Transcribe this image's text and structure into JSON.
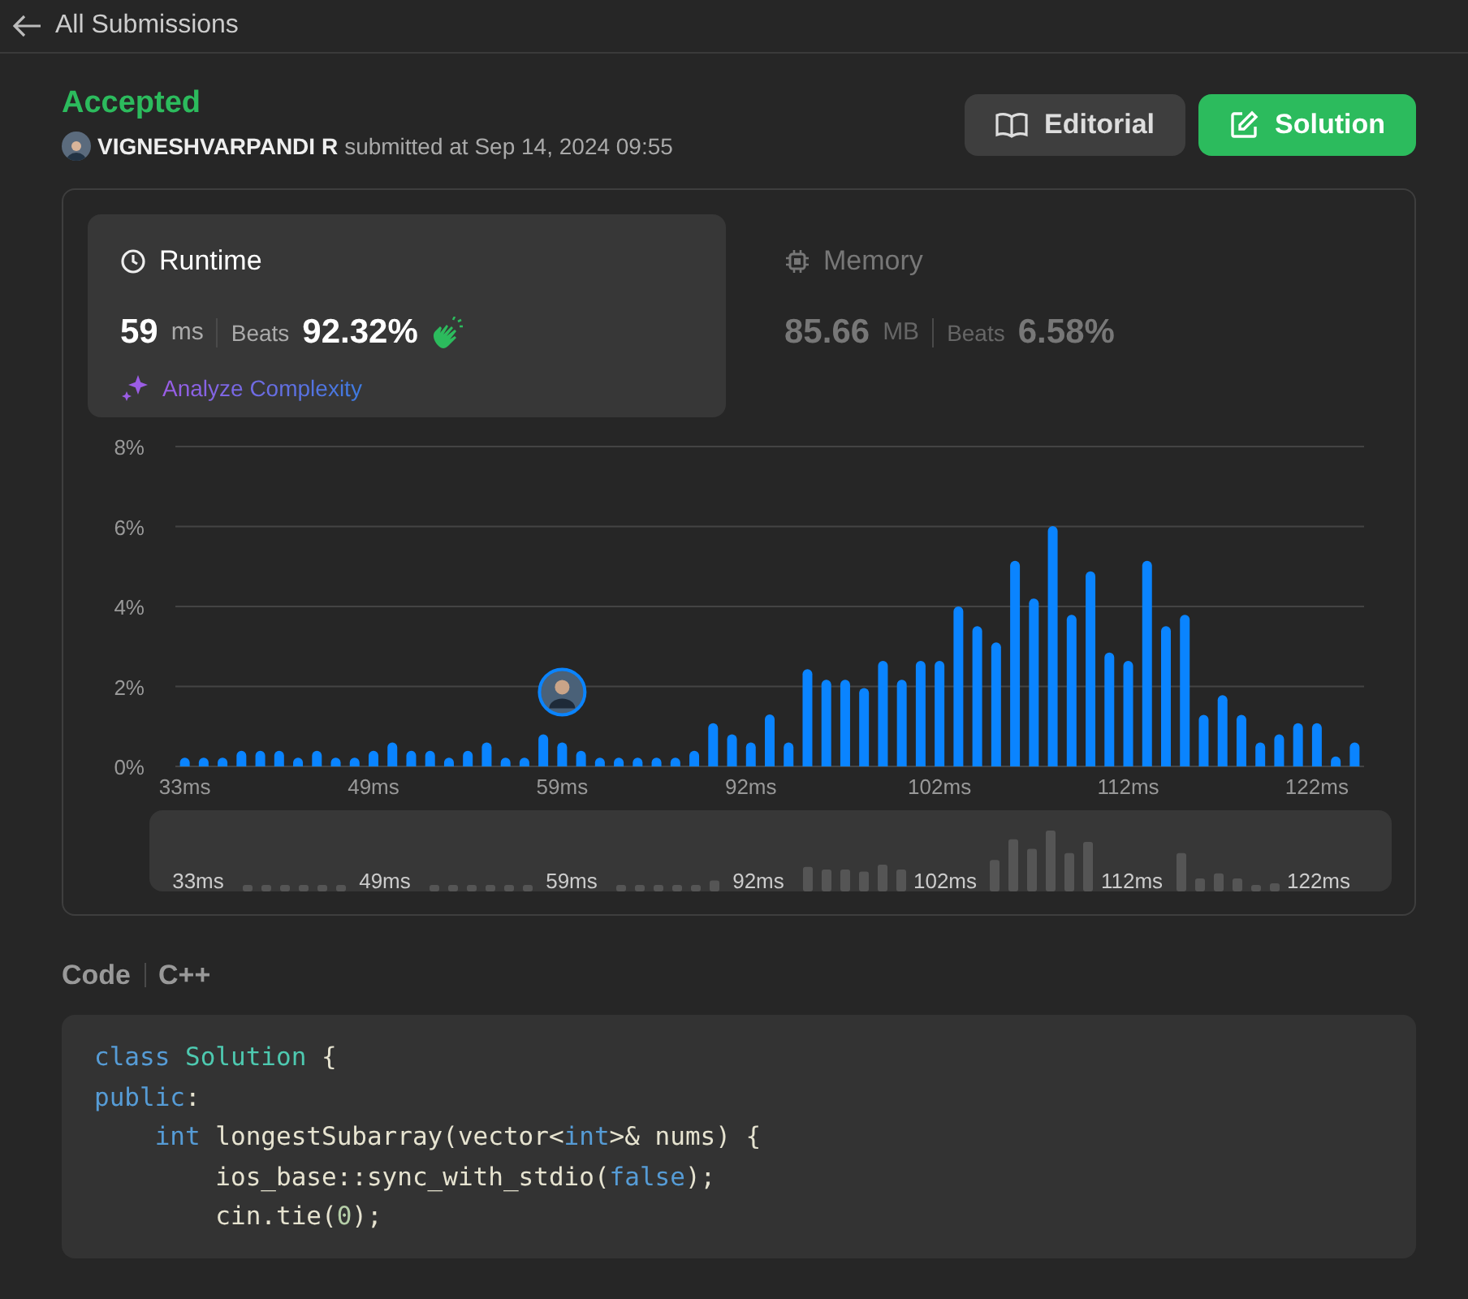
{
  "header": {
    "title": "All Submissions"
  },
  "submission": {
    "status": "Accepted",
    "author": "VIGNESHVARPANDI R",
    "submitted_text": "submitted at Sep 14, 2024 09:55"
  },
  "buttons": [
    {
      "label": "Editorial",
      "kind": "secondary"
    },
    {
      "label": "Solution",
      "kind": "primary"
    }
  ],
  "stats": [
    {
      "kind": "runtime",
      "title": "Runtime",
      "value": "59",
      "unit": "ms",
      "beats_label": "Beats",
      "beats": "92.32%",
      "selected": true,
      "link": "Analyze Complexity"
    },
    {
      "kind": "memory",
      "title": "Memory",
      "value": "85.66",
      "unit": "MB",
      "beats_label": "Beats",
      "beats": "6.58%",
      "selected": false
    }
  ],
  "chart_data": {
    "type": "bar",
    "ylim": [
      0,
      8
    ],
    "grid": true,
    "categories": [
      "33ms",
      null,
      null,
      null,
      null,
      null,
      null,
      null,
      null,
      null,
      "49ms",
      null,
      null,
      null,
      null,
      null,
      null,
      null,
      null,
      null,
      "59ms",
      null,
      null,
      null,
      null,
      null,
      null,
      null,
      null,
      null,
      "92ms",
      null,
      null,
      null,
      null,
      null,
      null,
      null,
      null,
      null,
      "102ms",
      null,
      null,
      null,
      null,
      null,
      null,
      null,
      null,
      null,
      "112ms",
      null,
      null,
      null,
      null,
      null,
      null,
      null,
      null,
      null,
      "122ms",
      null,
      null
    ],
    "yticks": [
      {
        "value": 0,
        "label": "0%"
      },
      {
        "value": 2,
        "label": "2%"
      },
      {
        "value": 4,
        "label": "4%"
      },
      {
        "value": 6,
        "label": "6%"
      },
      {
        "value": 8,
        "label": "8%"
      }
    ],
    "values": [
      0.22,
      0.22,
      0.22,
      0.39,
      0.39,
      0.39,
      0.22,
      0.39,
      0.22,
      0.22,
      0.39,
      0.6,
      0.39,
      0.39,
      0.22,
      0.39,
      0.6,
      0.22,
      0.22,
      0.8,
      0.6,
      0.39,
      0.22,
      0.22,
      0.22,
      0.22,
      0.22,
      0.39,
      1.08,
      0.8,
      0.6,
      1.3,
      0.6,
      2.43,
      2.17,
      2.17,
      1.96,
      2.64,
      2.17,
      2.64,
      2.64,
      4.0,
      3.51,
      3.1,
      5.14,
      4.2,
      6.01,
      3.79,
      4.88,
      2.85,
      2.64,
      5.14,
      3.51,
      3.79,
      1.29,
      1.78,
      1.29,
      0.6,
      0.8,
      1.08,
      1.08,
      0.25,
      0.6
    ],
    "annotations": [
      {
        "x": "59ms"
      }
    ]
  },
  "overview": {
    "labels": [
      "33ms",
      "49ms",
      "59ms",
      "92ms",
      "102ms",
      "112ms",
      "122ms"
    ]
  },
  "code": {
    "label": "Code",
    "language": "C++",
    "lines": [
      [
        {
          "t": "class",
          "color": "#569cd6"
        },
        {
          "t": " Solution",
          "color": "#4ec9b0"
        },
        {
          "t": " {",
          "color": "#e6e3d0"
        }
      ],
      [
        {
          "t": "public",
          "color": "#569cd6"
        },
        {
          "t": ":",
          "color": "#e6e3d0"
        }
      ],
      [
        {
          "t": "    int",
          "color": "#569cd6"
        },
        {
          "t": " longestSubarray(vector<",
          "color": "#e6e3d0"
        },
        {
          "t": "int",
          "color": "#569cd6"
        },
        {
          "t": ">& nums) {",
          "color": "#e6e3d0"
        }
      ],
      [
        {
          "t": "        ios_base::sync_with_stdio(",
          "color": "#e6e3d0"
        },
        {
          "t": "false",
          "color": "#569cd6"
        },
        {
          "t": ");",
          "color": "#e6e3d0"
        }
      ],
      [
        {
          "t": "        cin.tie(",
          "color": "#e6e3d0"
        },
        {
          "t": "0",
          "color": "#b5cea8"
        },
        {
          "t": ");",
          "color": "#e6e3d0"
        }
      ]
    ]
  }
}
